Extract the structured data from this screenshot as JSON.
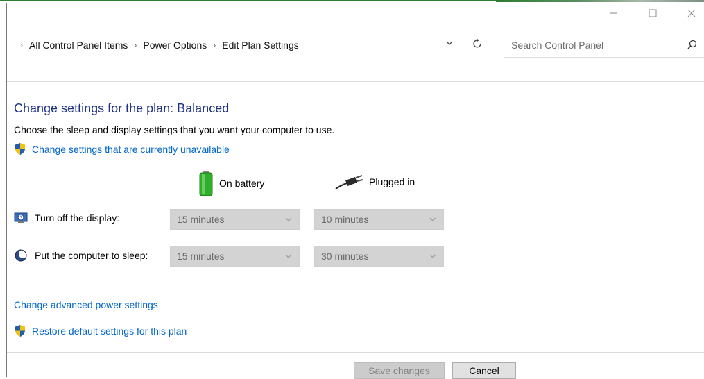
{
  "window": {
    "controls": [
      "minimize",
      "maximize",
      "close"
    ]
  },
  "breadcrumb": {
    "items": [
      "All Control Panel Items",
      "Power Options",
      "Edit Plan Settings"
    ]
  },
  "search": {
    "placeholder": "Search Control Panel"
  },
  "main": {
    "title": "Change settings for the plan: Balanced",
    "subtitle": "Choose the sleep and display settings that you want your computer to use.",
    "unavailable_link": "Change settings that are currently unavailable",
    "columns": {
      "battery": "On battery",
      "plugged": "Plugged in"
    },
    "rows": [
      {
        "label": "Turn off the display:",
        "battery": "15 minutes",
        "plugged": "10 minutes",
        "icon": "display-icon"
      },
      {
        "label": "Put the computer to sleep:",
        "battery": "15 minutes",
        "plugged": "30 minutes",
        "icon": "sleep-icon"
      }
    ],
    "advanced_link": "Change advanced power settings",
    "restore_link": "Restore default settings for this plan"
  },
  "buttons": {
    "save": "Save changes",
    "cancel": "Cancel"
  },
  "colors": {
    "title": "#1e3287",
    "link": "#0066cc",
    "disabled_select": "#d3d3d3"
  }
}
